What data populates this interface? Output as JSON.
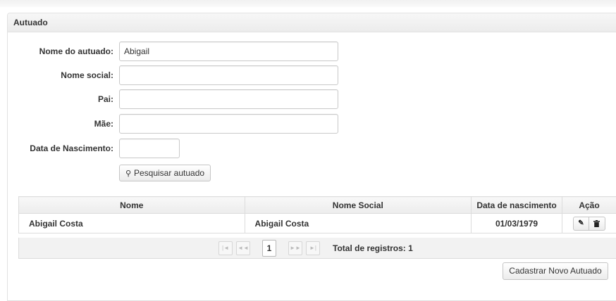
{
  "panel": {
    "title": "Autuado"
  },
  "form": {
    "nome_label": "Nome do autuado:",
    "nome_value": "Abigail",
    "nome_social_label": "Nome social:",
    "nome_social_value": "",
    "pai_label": "Pai:",
    "pai_value": "",
    "mae_label": "Mãe:",
    "mae_value": "",
    "nascimento_label": "Data de Nascimento:",
    "nascimento_value": "",
    "search_label": "Pesquisar autuado",
    "search_icon": "search-icon"
  },
  "table": {
    "columns": [
      "Nome",
      "Nome Social",
      "Data de nascimento",
      "Ação"
    ],
    "rows": [
      {
        "nome": "Abigail Costa",
        "nome_social": "Abigail Costa",
        "nascimento": "01/03/1979"
      }
    ]
  },
  "paginator": {
    "first": "|◄",
    "prev": "◄◄",
    "page": "1",
    "next": "►►",
    "last": "►|",
    "total": "Total de registros: 1"
  },
  "actions": {
    "new_label": "Cadastrar Novo Autuado"
  }
}
